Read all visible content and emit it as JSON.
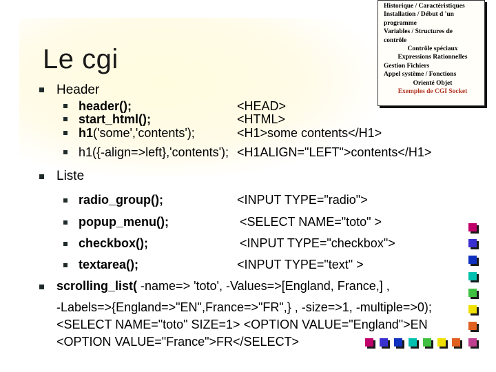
{
  "title": "Le cgi",
  "nav": {
    "items": [
      "Historique / Caractéristiques",
      "Installation / Début d 'un",
      "programme",
      "Variables / Structures de",
      "contrôle",
      "Contrôle spéciaux",
      "Expressions Rationnelles",
      "Gestion Fichiers",
      "Appel système / Fonctions",
      "Orienté Objet"
    ],
    "active": "Exemples de CGI Socket"
  },
  "header": {
    "label": "Header",
    "rows": [
      {
        "func": "header();",
        "html": "<HEAD>"
      },
      {
        "func": "start_html();",
        "html": "<HTML>"
      },
      {
        "func": "h1('some','contents');",
        "html": "<H1>some contents</H1>"
      },
      {
        "func": "h1({-align=>left},'contents');",
        "html": "<H1ALIGN=\"LEFT\">contents</H1>"
      }
    ]
  },
  "liste": {
    "label": "Liste",
    "rows": [
      {
        "func": "radio_group();",
        "html": "<INPUT TYPE=\"radio\">"
      },
      {
        "func": "popup_menu();",
        "html": "<SELECT NAME=\"toto\" >"
      },
      {
        "func": "checkbox();",
        "html": "<INPUT TYPE=\"checkbox\">"
      },
      {
        "func": "textarea();",
        "html": "<INPUT TYPE=\"text\" >"
      }
    ]
  },
  "scrolling": {
    "func": "scrolling_list(",
    "line1_rest": " -name=> 'toto', -Values=>[England, France,] ,",
    "line2": "-Labels=>{England=>\"EN\",France=>\"FR\",} , -size=>1,   -multiple=>0);",
    "line3": "<SELECT NAME=\"toto\" SIZE=1> <OPTION  VALUE=\"England\">EN",
    "line4": "<OPTION  VALUE=\"France\">FR</SELECT>"
  },
  "decor_colors": [
    "#c0006a",
    "#3a2fd0",
    "#1030c0",
    "#00c0b0",
    "#40c040",
    "#f0e000",
    "#e06020",
    "#c04090"
  ]
}
